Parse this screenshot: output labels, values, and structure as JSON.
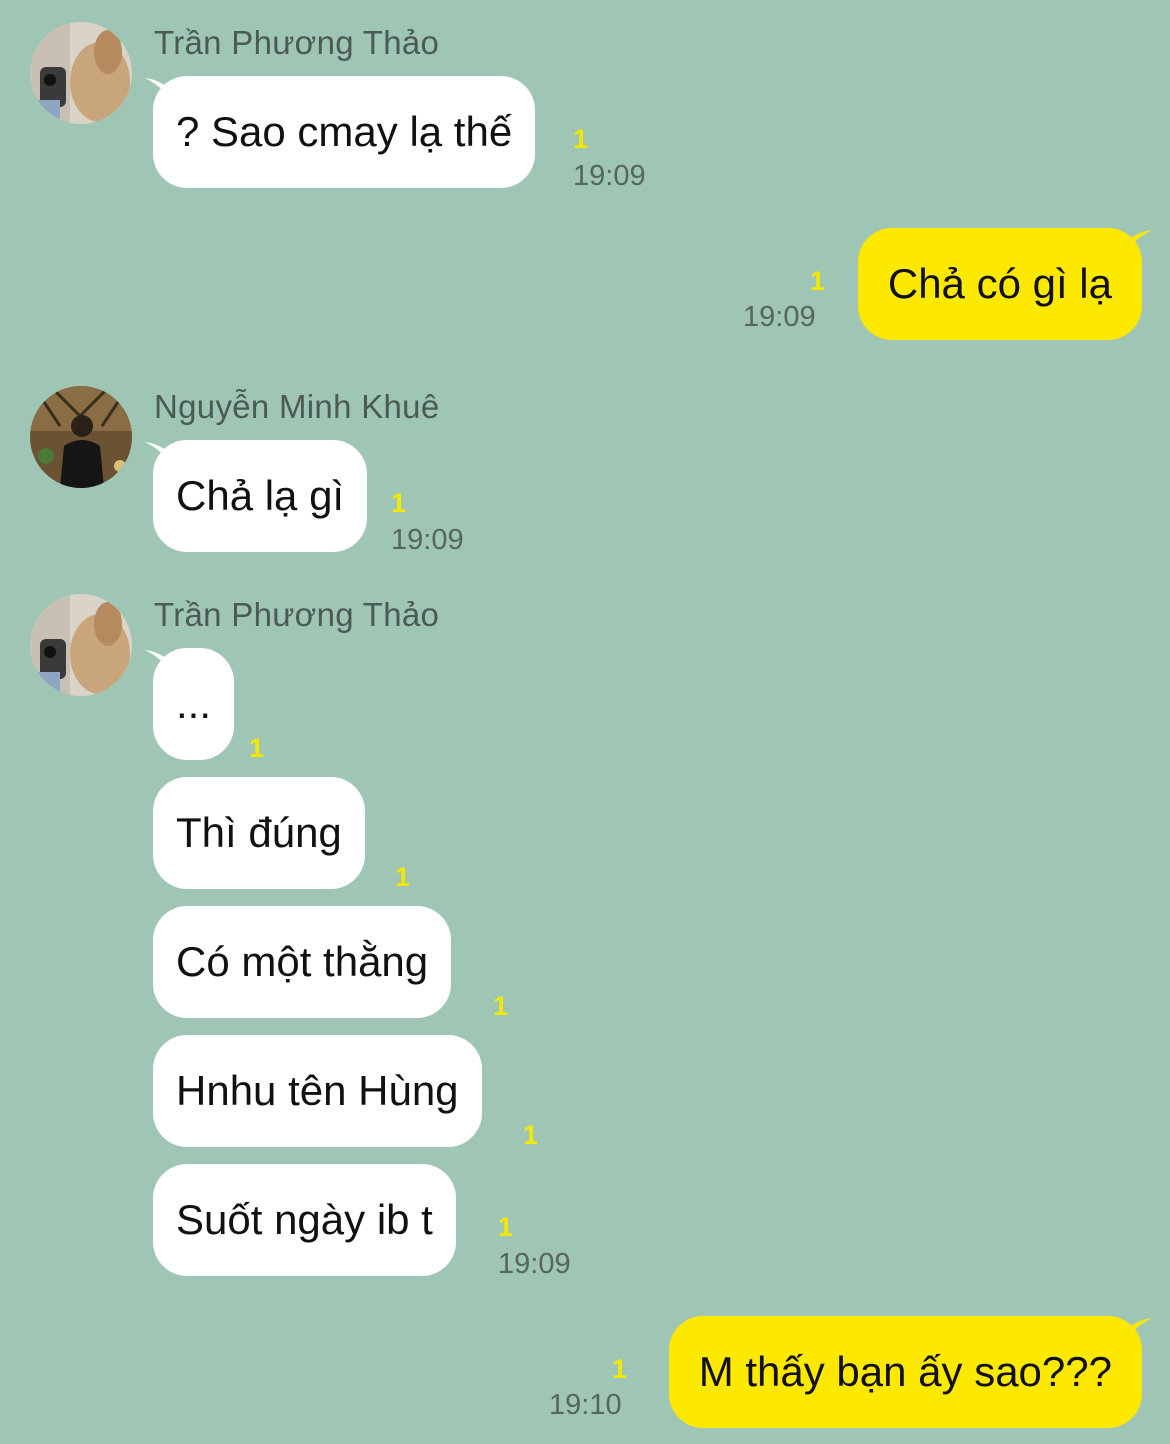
{
  "colors": {
    "background": "#9fc6b5",
    "incoming_bubble": "#ffffff",
    "outgoing_bubble": "#fde800",
    "unread_count": "#f5e800",
    "timestamp": "#56665f"
  },
  "messages": [
    {
      "sender": "Trần Phương Thảo",
      "text": "? Sao cmay lạ thế",
      "unread": "1",
      "time": "19:09"
    },
    {
      "text": "Chả có gì lạ",
      "unread": "1",
      "time": "19:09"
    },
    {
      "sender": "Nguyễn Minh Khuê",
      "text": "Chả lạ gì",
      "unread": "1",
      "time": "19:09"
    },
    {
      "sender": "Trần Phương Thảo",
      "text": "...",
      "unread": "1"
    },
    {
      "text": "Thì đúng",
      "unread": "1"
    },
    {
      "text": "Có một thằng",
      "unread": "1"
    },
    {
      "text": "Hnhu tên Hùng",
      "unread": "1"
    },
    {
      "text": "Suốt ngày ib t",
      "unread": "1",
      "time": "19:09"
    },
    {
      "text": "M thấy bạn ấy sao???",
      "unread": "1",
      "time": "19:10"
    }
  ]
}
